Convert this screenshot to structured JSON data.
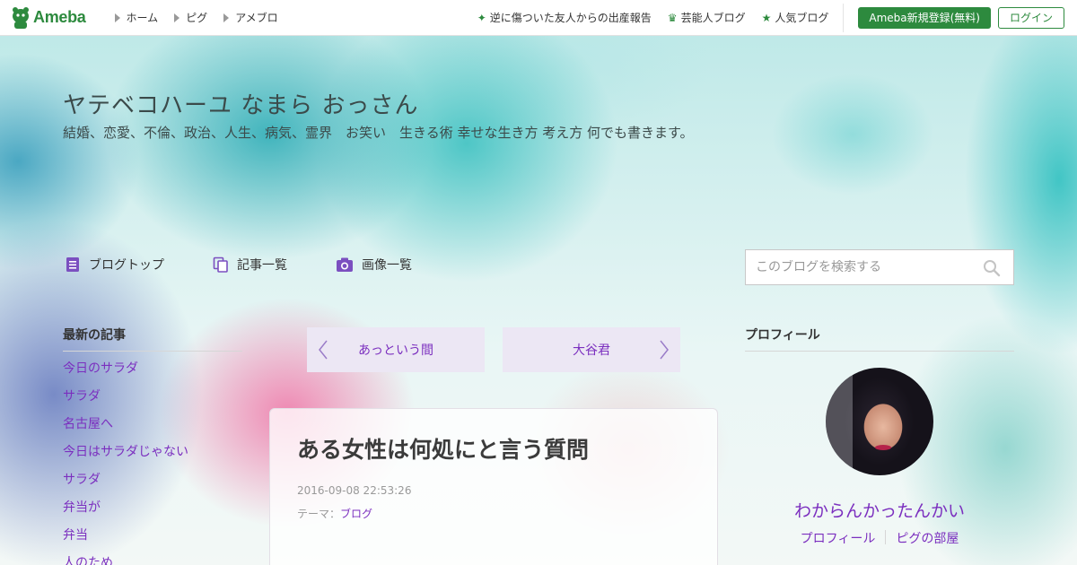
{
  "header": {
    "logo_text": "Ameba",
    "nav": [
      {
        "label": "ホーム"
      },
      {
        "label": "ピグ"
      },
      {
        "label": "アメブロ"
      }
    ],
    "right_links": [
      {
        "label": "逆に傷ついた友人からの出産報告",
        "icon": "sparkle-icon"
      },
      {
        "label": "芸能人ブログ",
        "icon": "crown-icon"
      },
      {
        "label": "人気ブログ",
        "icon": "star-icon"
      }
    ],
    "register_label": "Ameba新規登録(無料)",
    "login_label": "ログイン"
  },
  "blog": {
    "title": "ヤテベコハーユ なまら おっさん",
    "description": "結婚、恋愛、不倫、政治、人生、病気、霊界　お笑い　生きる術 幸せな生き方 考え方 何でも書きます。"
  },
  "blog_nav": [
    {
      "label": "ブログトップ",
      "icon": "document-icon"
    },
    {
      "label": "記事一覧",
      "icon": "copy-icon"
    },
    {
      "label": "画像一覧",
      "icon": "camera-icon"
    }
  ],
  "search": {
    "placeholder": "このブログを検索する"
  },
  "sidebar": {
    "heading": "最新の記事",
    "items": [
      {
        "label": "今日のサラダ"
      },
      {
        "label": "サラダ"
      },
      {
        "label": "名古屋へ"
      },
      {
        "label": "今日はサラダじゃない"
      },
      {
        "label": "サラダ"
      },
      {
        "label": "弁当が"
      },
      {
        "label": "弁当"
      },
      {
        "label": "人のため"
      }
    ]
  },
  "pager": {
    "prev_label": "あっという間",
    "next_label": "大谷君"
  },
  "article": {
    "title": "ある女性は何処にと言う質問",
    "date": "2016-09-08 22:53:26",
    "theme_prefix": "テーマ：",
    "theme_link": "ブログ"
  },
  "profile": {
    "heading": "プロフィール",
    "name": "わからんかったんかい",
    "links": [
      {
        "label": "プロフィール"
      },
      {
        "label": "ピグの部屋"
      }
    ]
  },
  "colors": {
    "brand_green": "#2d8a3e",
    "link_purple": "#7b2fbf",
    "pager_bg": "#ece7f4"
  }
}
